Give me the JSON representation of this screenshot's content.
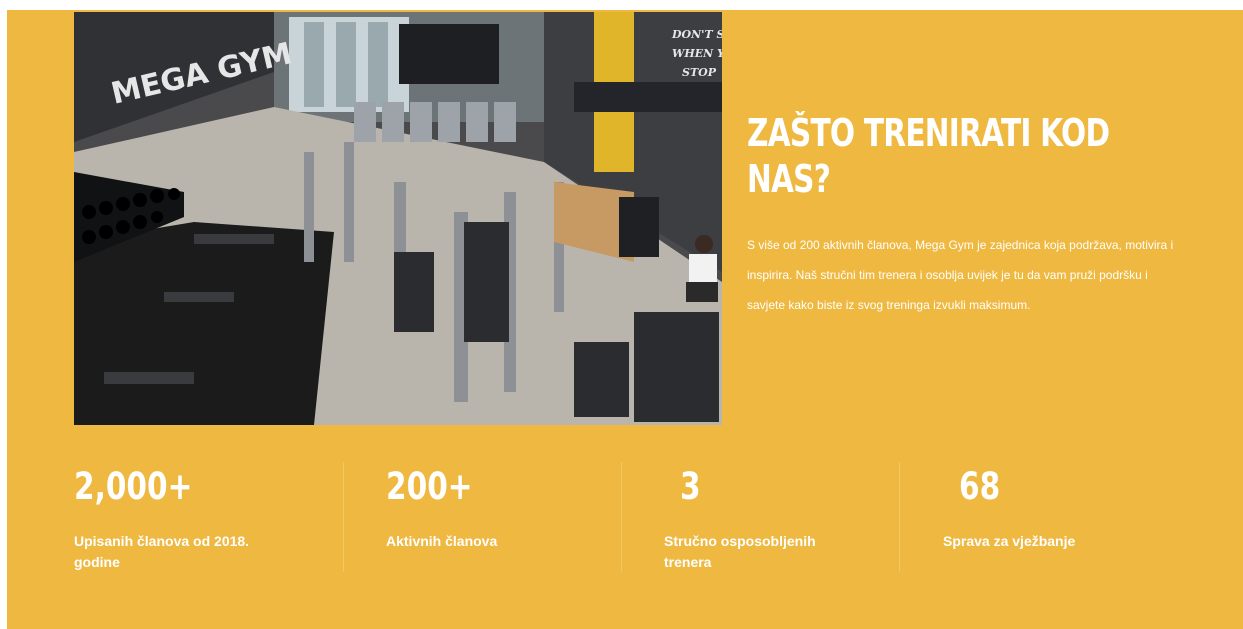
{
  "colors": {
    "section_background": "#efb841",
    "text": "#ffffff"
  },
  "hero": {
    "image": {
      "description_icon": "gym-interior-photo",
      "wall_sign": "MEGA GYM",
      "wall_slogan_lines": [
        "DON'T ST",
        "WHEN YOU",
        "STOP"
      ]
    },
    "heading": "ZAŠTO TRENIRATI KOD NAS?",
    "description": "S više od 200 aktivnih članova, Mega Gym je zajednica koja podržava, motivira i inspirira. Naš stručni tim trenera i osoblja uvijek je tu da vam pruži podršku i savjete kako biste iz svog treninga izvukli maksimum."
  },
  "stats": [
    {
      "value": "2,000+",
      "label": "Upisanih članova od 2018. godine"
    },
    {
      "value": "200+",
      "label": "Aktivnih članova"
    },
    {
      "value": "3",
      "label": "Stručno osposobljenih trenera"
    },
    {
      "value": "68",
      "label": "Sprava za vježbanje"
    }
  ]
}
